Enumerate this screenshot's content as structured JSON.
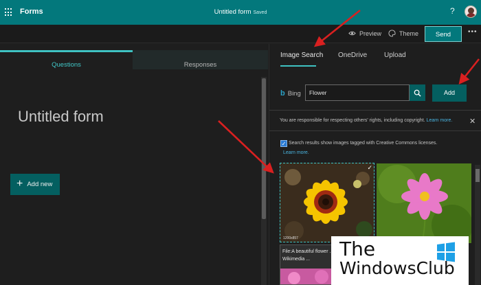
{
  "topbar": {
    "app_name": "Forms",
    "doc_title": "Untitled form",
    "saved_status": "Saved",
    "help": "?"
  },
  "toolbar": {
    "preview_label": "Preview",
    "theme_label": "Theme",
    "send_label": "Send",
    "more": "•••"
  },
  "left": {
    "tabs": [
      {
        "label": "Questions",
        "active": true
      },
      {
        "label": "Responses",
        "active": false
      }
    ],
    "form_title": "Untitled form",
    "add_new_label": "Add new"
  },
  "right": {
    "tabs": [
      {
        "label": "Image Search",
        "active": true
      },
      {
        "label": "OneDrive",
        "active": false
      },
      {
        "label": "Upload",
        "active": false
      }
    ],
    "bing_label": "Bing",
    "search_value": "Flower",
    "add_label": "Add",
    "notice_text": "You are responsible for respecting others' rights, including copyright.",
    "notice_link": "Learn more.",
    "cc_text": "Search results show images tagged with Creative Commons licenses.",
    "cc_checked": true,
    "cc_link": "Learn more.",
    "results": [
      {
        "dimensions": "1200x857",
        "selected": true
      },
      {
        "dimensions": "",
        "selected": false
      },
      {
        "caption": "File:A beautiful flower ... - Wikimedia ..."
      }
    ]
  },
  "watermark": {
    "line1": "The",
    "line2": "WindowsClub"
  },
  "colors": {
    "brand": "#03787c",
    "accent": "#3fc3c3",
    "button": "#045f60",
    "annotation_arrow": "#d92020",
    "link": "#4ab6e3"
  },
  "icons": [
    "waffle-icon",
    "help-icon",
    "avatar",
    "preview-eye-icon",
    "theme-palette-icon",
    "more-icon",
    "plus-icon",
    "bing-logo-icon",
    "search-icon",
    "close-icon",
    "checkmark-icon"
  ]
}
